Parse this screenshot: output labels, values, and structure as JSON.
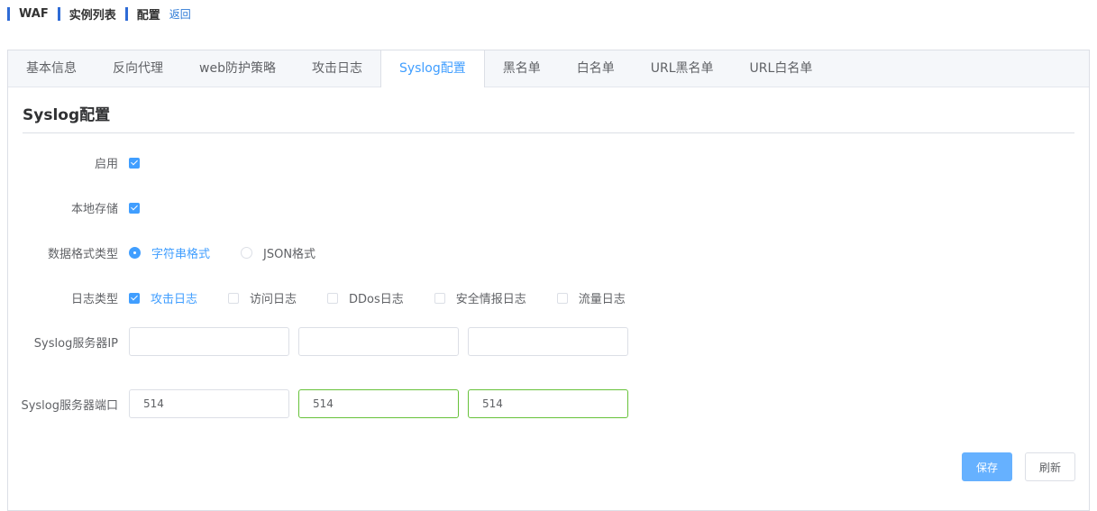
{
  "breadcrumb": {
    "items": [
      "WAF",
      "实例列表",
      "配置"
    ],
    "back": "返回"
  },
  "tabs": [
    {
      "label": "基本信息",
      "active": false
    },
    {
      "label": "反向代理",
      "active": false
    },
    {
      "label": "web防护策略",
      "active": false
    },
    {
      "label": "攻击日志",
      "active": false
    },
    {
      "label": "Syslog配置",
      "active": true
    },
    {
      "label": "黑名单",
      "active": false
    },
    {
      "label": "白名单",
      "active": false
    },
    {
      "label": "URL黑名单",
      "active": false
    },
    {
      "label": "URL白名单",
      "active": false
    }
  ],
  "section": {
    "title": "Syslog配置"
  },
  "form": {
    "enable": {
      "label": "启用",
      "checked": true
    },
    "local_storage": {
      "label": "本地存储",
      "checked": true
    },
    "data_format": {
      "label": "数据格式类型",
      "options": [
        {
          "label": "字符串格式",
          "selected": true
        },
        {
          "label": "JSON格式",
          "selected": false
        }
      ]
    },
    "log_types": {
      "label": "日志类型",
      "options": [
        {
          "label": "攻击日志",
          "checked": true
        },
        {
          "label": "访问日志",
          "checked": false
        },
        {
          "label": "DDos日志",
          "checked": false
        },
        {
          "label": "安全情报日志",
          "checked": false
        },
        {
          "label": "流量日志",
          "checked": false
        }
      ]
    },
    "server_ip": {
      "label": "Syslog服务器IP",
      "values": [
        "",
        "",
        ""
      ]
    },
    "server_port": {
      "label": "Syslog服务器端口",
      "values": [
        "514",
        "514",
        "514"
      ]
    }
  },
  "buttons": {
    "save": "保存",
    "refresh": "刷新"
  },
  "colors": {
    "accent": "#409eff",
    "breadcrumb_bar": "#2e6bd6",
    "valid_border": "#67c23a"
  }
}
